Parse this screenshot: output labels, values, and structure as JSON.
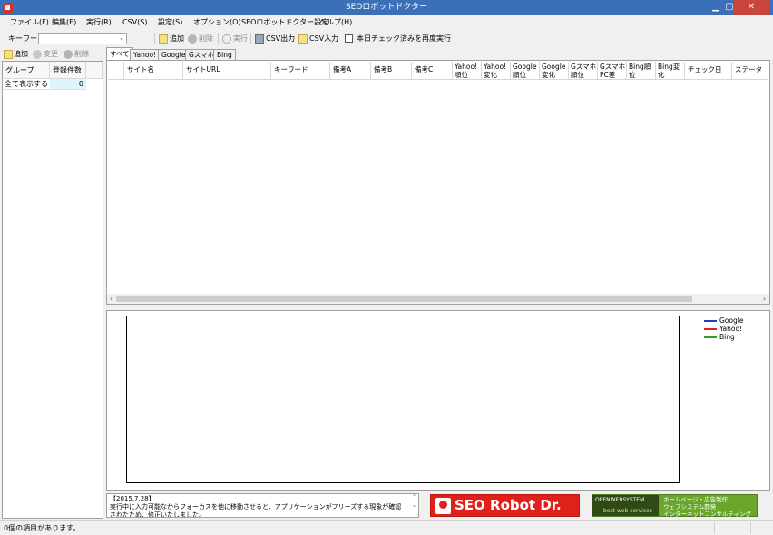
{
  "window": {
    "title": "SEOロボットドクター",
    "min_glyph": "▁",
    "max_glyph": "▢",
    "close_glyph": "✕"
  },
  "menu": [
    "ファイル(F)",
    "編集(E)",
    "実行(R)",
    "CSV(S)",
    "設定(S)",
    "オプション(O)",
    "SEOロボットドクター設定",
    "ヘルプ(H)"
  ],
  "toolbar": {
    "keyword_label": "キーワード",
    "keyword_value": "",
    "add": "追加",
    "delete": "削除",
    "run": "実行",
    "csv_export": "CSV出力",
    "csv_import": "CSV入力",
    "recheck": "本日チェック済みを再度実行"
  },
  "left_toolbar": {
    "add": "追加",
    "edit": "変更",
    "delete": "削除"
  },
  "groups": {
    "headers": [
      "グループ",
      "登録件数"
    ],
    "rows": [
      {
        "name": "全て表示する",
        "count": "0"
      }
    ]
  },
  "tabs": [
    "すべて",
    "Yahoo!",
    "Google",
    "Gスマホ",
    "Bing"
  ],
  "columns": [
    "サイト名",
    "サイトURL",
    "キーワード",
    "備考A",
    "備考B",
    "備考C",
    "Yahoo!\n順位",
    "Yahoo!\n変化",
    "Google\n順位",
    "Google\n変化",
    "Gスマホ\n順位",
    "Gスマホ\nPC差",
    "Bing順\n位",
    "Bing変\n化",
    "チェック日",
    "ステータス"
  ],
  "chart_data": {
    "type": "line",
    "x": [],
    "series": [
      {
        "name": "Google",
        "values": [],
        "color": "#1f3fbf"
      },
      {
        "name": "Yahoo!",
        "values": [],
        "color": "#e02020"
      },
      {
        "name": "Bing",
        "values": [],
        "color": "#2e9e2e"
      }
    ],
    "legend": "top-right",
    "grid": false
  },
  "notice": {
    "text": "【2015.7.28】\n実行中に入力可能なからフォーカスを他に移動させると、アプリケーションがフリーズする現象が確認されたため、修正いたしました。"
  },
  "banners": {
    "seo": "SEO Robot Dr.",
    "ows_logo": "OPENWEBSYSTEM",
    "ows_sub": "best web services",
    "ows_line1": "ホームページ・広告制作",
    "ows_line2": "ウェブシステム開発",
    "ows_line3": "インターネットコンサルティング"
  },
  "status": {
    "text": "0個の項目があります。"
  }
}
